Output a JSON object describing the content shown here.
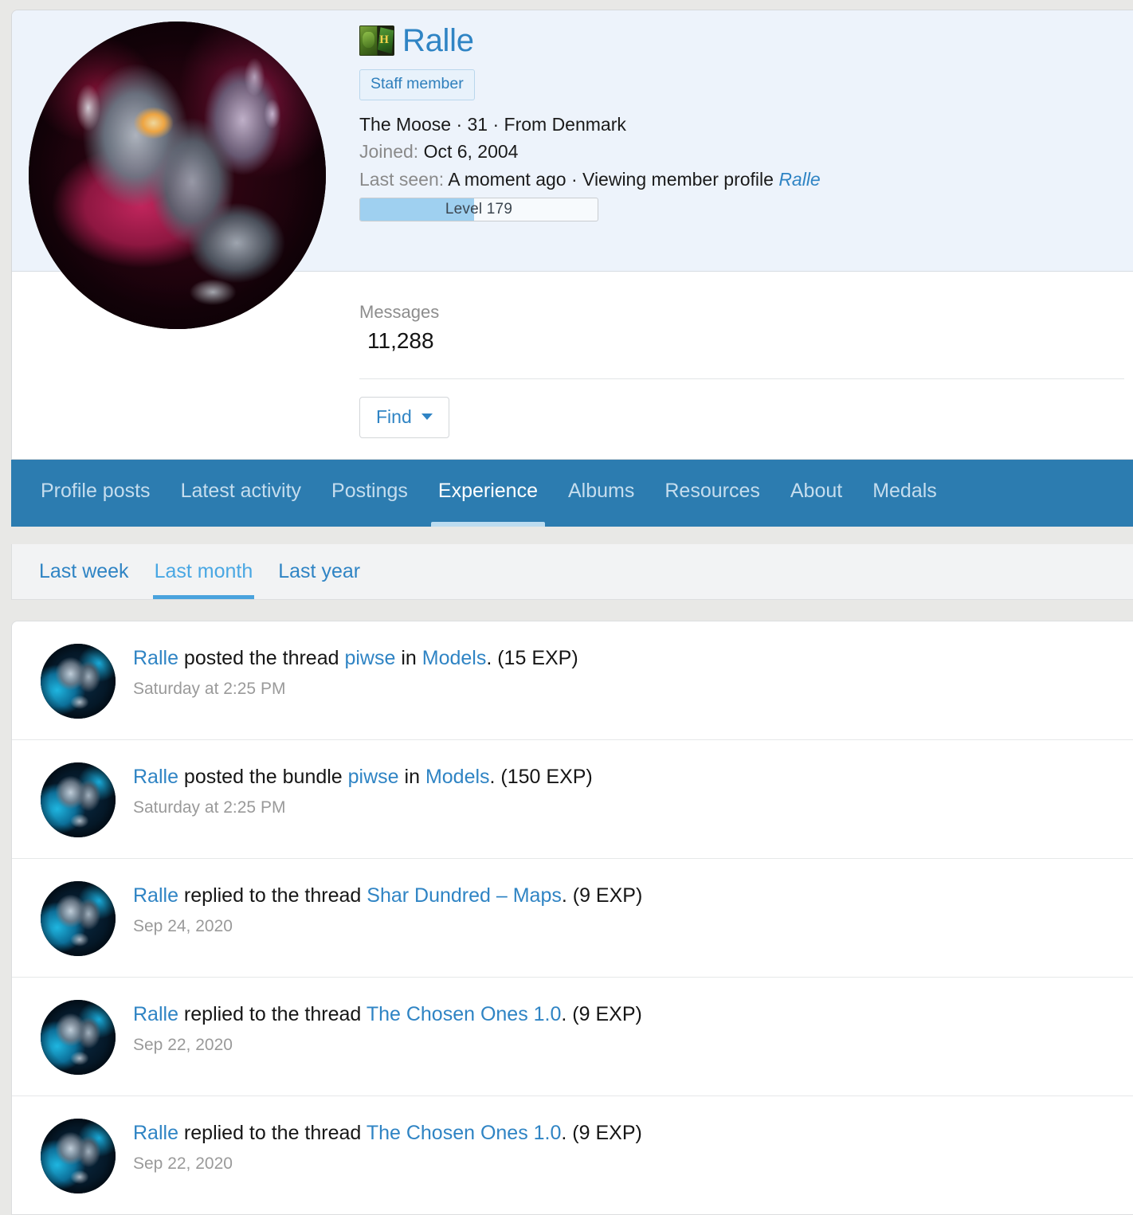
{
  "profile": {
    "username": "Ralle",
    "rank_icon": "orc-rank-icon",
    "avatar_icon": "user-avatar",
    "badges": [
      "Staff member"
    ],
    "title_line": "The Moose · 31 · From Denmark",
    "joined_label": "Joined:",
    "joined_value": "Oct 6, 2004",
    "last_seen_label": "Last seen:",
    "last_seen_value": "A moment ago · Viewing member profile",
    "last_seen_link": "Ralle",
    "level_text": "Level 179",
    "level_percent": 48,
    "stats": {
      "messages_label": "Messages",
      "messages_value": "11,288"
    },
    "find_button": "Find"
  },
  "tabs": [
    {
      "label": "Profile posts",
      "active": false
    },
    {
      "label": "Latest activity",
      "active": false
    },
    {
      "label": "Postings",
      "active": false
    },
    {
      "label": "Experience",
      "active": true
    },
    {
      "label": "Albums",
      "active": false
    },
    {
      "label": "Resources",
      "active": false
    },
    {
      "label": "About",
      "active": false
    },
    {
      "label": "Medals",
      "active": false
    }
  ],
  "subtabs": [
    {
      "label": "Last week",
      "active": false
    },
    {
      "label": "Last month",
      "active": true
    },
    {
      "label": "Last year",
      "active": false
    }
  ],
  "activity": [
    {
      "user": "Ralle",
      "action_before": " posted the thread ",
      "target": "piwse",
      "action_mid": " in ",
      "container": "Models",
      "suffix": ". (15 EXP)",
      "date": "Saturday at 2:25 PM"
    },
    {
      "user": "Ralle",
      "action_before": " posted the bundle ",
      "target": "piwse",
      "action_mid": " in ",
      "container": "Models",
      "suffix": ". (150 EXP)",
      "date": "Saturday at 2:25 PM"
    },
    {
      "user": "Ralle",
      "action_before": " replied to the thread ",
      "target": "Shar Dundred – Maps",
      "action_mid": "",
      "container": "",
      "suffix": ". (9 EXP)",
      "date": "Sep 24, 2020"
    },
    {
      "user": "Ralle",
      "action_before": " replied to the thread ",
      "target": "The Chosen Ones 1.0",
      "action_mid": "",
      "container": "",
      "suffix": ". (9 EXP)",
      "date": "Sep 22, 2020"
    },
    {
      "user": "Ralle",
      "action_before": " replied to the thread ",
      "target": "The Chosen Ones 1.0",
      "action_mid": "",
      "container": "",
      "suffix": ". (9 EXP)",
      "date": "Sep 22, 2020"
    }
  ],
  "colors": {
    "accent_link": "#2f84c4",
    "tabbar_bg": "#2c7cb0",
    "banner_bg": "#edf3fb",
    "level_fill": "#9fd0f0",
    "page_bg": "#e8e8e6"
  }
}
